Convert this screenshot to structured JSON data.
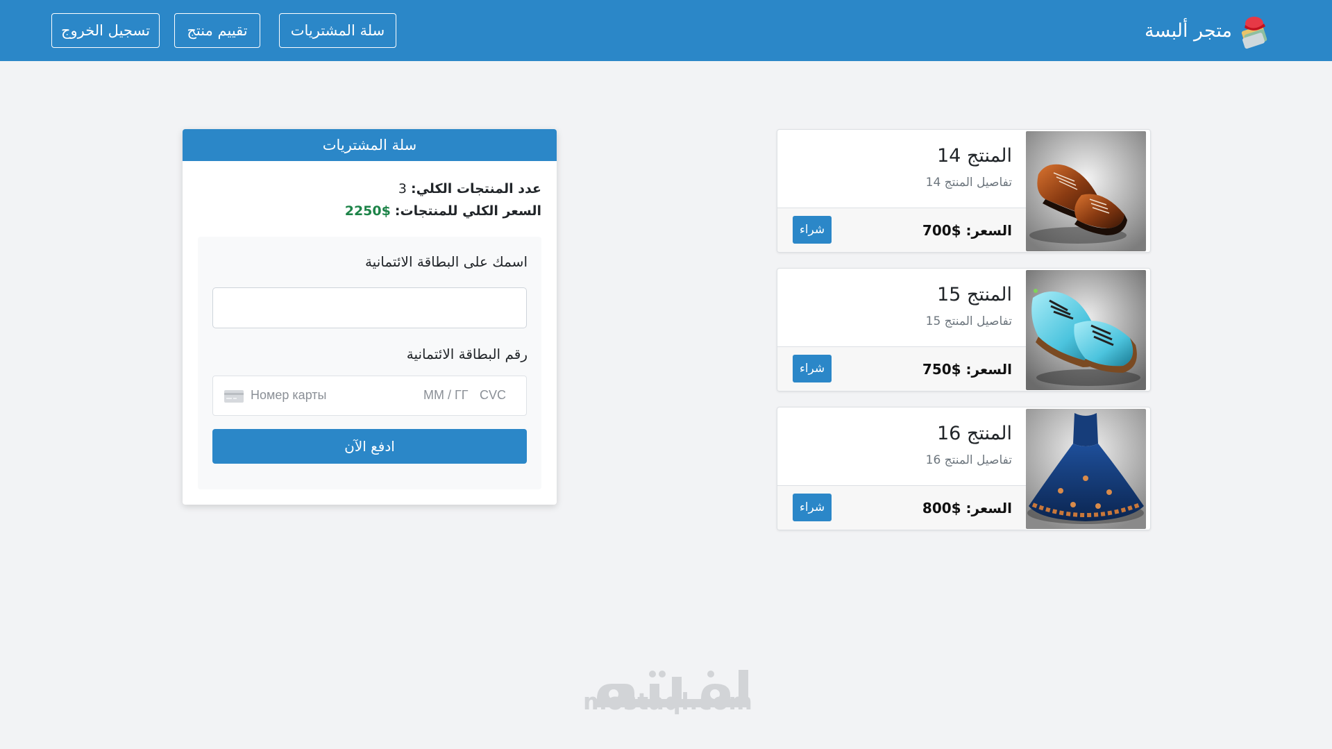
{
  "navbar": {
    "brand": "متجر ألبسة",
    "buttons": {
      "cart": "سلة المشتريات",
      "rate": "تقييم منتج",
      "logout": "تسجيل الخروج"
    },
    "color": "#2b87c8"
  },
  "products": [
    {
      "title": "المنتج 14",
      "description": "تفاصيل المنتج 14",
      "price": "السعر: $700",
      "buy": "شراء",
      "image": "brown-leather-shoes"
    },
    {
      "title": "المنتج 15",
      "description": "تفاصيل المنتج 15",
      "price": "السعر: $750",
      "buy": "شراء",
      "image": "light-blue-shoes"
    },
    {
      "title": "المنتج 16",
      "description": "تفاصيل المنتج 16",
      "price": "السعر: $800",
      "buy": "شراء",
      "image": "blue-gown-dress"
    }
  ],
  "cart": {
    "header": "سلة المشتريات",
    "count_label": "عدد المنتجات الكلي:",
    "count_value": "3",
    "total_label": "السعر الكلي للمنتجات:",
    "total_value": "$2250",
    "total_color": "#1e8449",
    "name_label": "اسمك على البطاقة الائتمانية",
    "name_value": "",
    "card_label": "رقم البطاقة الائتمانية",
    "card_placeholder": "Номер карты",
    "expiry_placeholder": "ММ / ГГ",
    "cvc_placeholder": "CVC",
    "pay_button": "ادفع الآن"
  },
  "watermark": {
    "text": "mostaql.com"
  }
}
